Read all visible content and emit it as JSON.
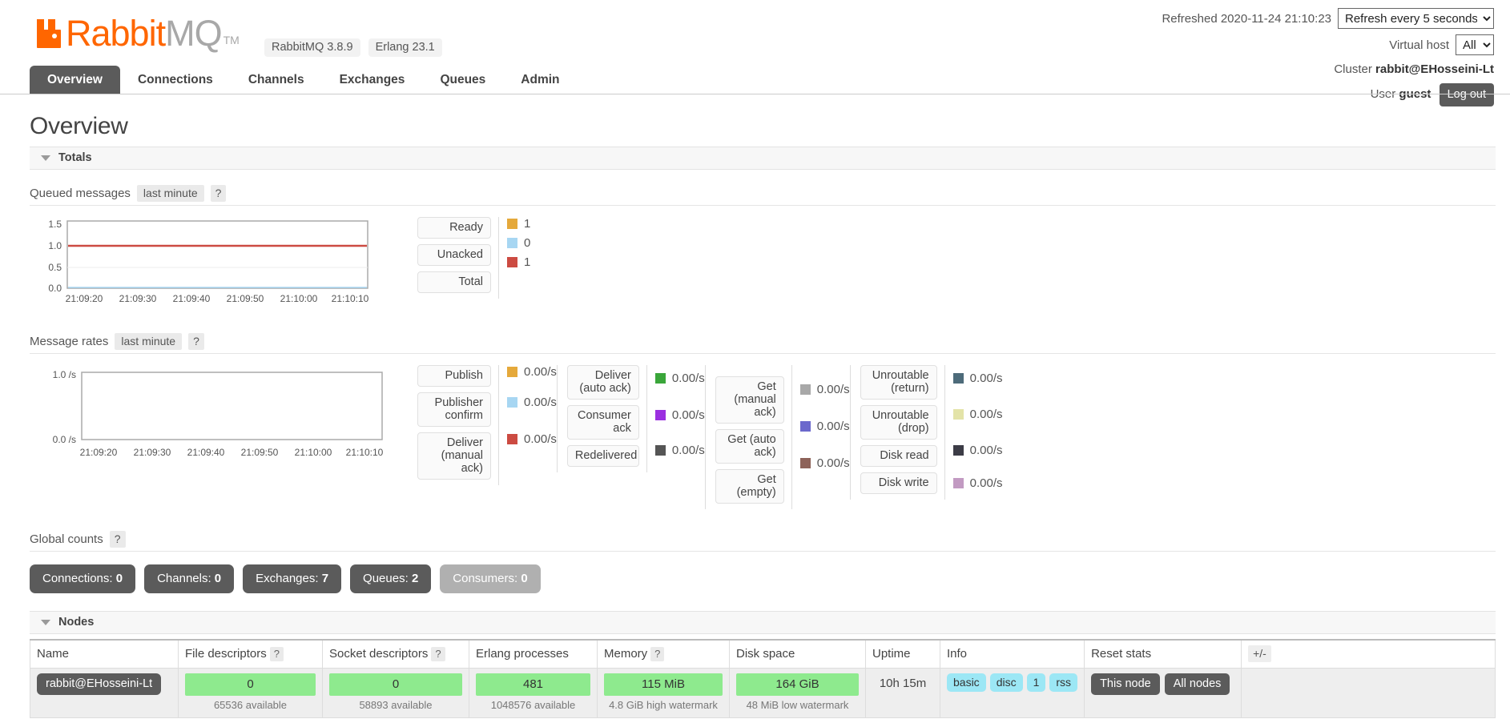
{
  "brand": {
    "name_part1": "Rabbit",
    "name_part2": "MQ",
    "tm": "TM",
    "logo_color": "#ff6600",
    "versions": [
      {
        "label": "RabbitMQ 3.8.9"
      },
      {
        "label": "Erlang 23.1"
      }
    ]
  },
  "topbar": {
    "refreshed_label": "Refreshed 2020-11-24 21:10:23",
    "refresh_select_value": "Refresh every 5 seconds",
    "refresh_options": [
      "Refresh every 5 seconds"
    ],
    "vhost_label": "Virtual host",
    "vhost_select_value": "All",
    "vhost_options": [
      "All"
    ],
    "cluster_label": "Cluster",
    "cluster_name": "rabbit@EHosseini-Lt",
    "user_label": "User",
    "user_name": "guest",
    "logout_label": "Log out"
  },
  "nav": {
    "tabs": [
      {
        "label": "Overview",
        "active": true
      },
      {
        "label": "Connections",
        "active": false
      },
      {
        "label": "Channels",
        "active": false
      },
      {
        "label": "Exchanges",
        "active": false
      },
      {
        "label": "Queues",
        "active": false
      },
      {
        "label": "Admin",
        "active": false
      }
    ]
  },
  "page": {
    "title": "Overview"
  },
  "totals": {
    "section_label": "Totals",
    "queued": {
      "title": "Queued messages",
      "period": "last minute",
      "help": "?"
    },
    "rates": {
      "title": "Message rates",
      "period": "last minute",
      "help": "?"
    }
  },
  "global_counts": {
    "title": "Global counts",
    "help": "?",
    "badges": [
      {
        "label": "Connections:",
        "value": "0",
        "muted": false
      },
      {
        "label": "Channels:",
        "value": "0",
        "muted": false
      },
      {
        "label": "Exchanges:",
        "value": "7",
        "muted": false
      },
      {
        "label": "Queues:",
        "value": "2",
        "muted": false
      },
      {
        "label": "Consumers:",
        "value": "0",
        "muted": true
      }
    ]
  },
  "nodes": {
    "section_label": "Nodes",
    "columns": [
      "Name",
      "File descriptors",
      "Socket descriptors",
      "Erlang processes",
      "Memory",
      "Disk space",
      "Uptime",
      "Info",
      "Reset stats"
    ],
    "col_help": {
      "file_descriptors": "?",
      "socket_descriptors": "?",
      "memory": "?"
    },
    "plusminus": "+/-",
    "row": {
      "name": "rabbit@EHosseini-Lt",
      "file_descriptors": "0",
      "file_descriptors_note": "65536 available",
      "socket_descriptors": "0",
      "socket_descriptors_note": "58893 available",
      "erlang_processes": "481",
      "erlang_processes_note": "1048576 available",
      "memory": "115 MiB",
      "memory_note": "4.8 GiB high watermark",
      "disk_space": "164 GiB",
      "disk_space_note": "48 MiB low watermark",
      "uptime": "10h 15m",
      "info_tags": [
        "basic",
        "disc",
        "1",
        "rss"
      ],
      "reset_buttons": [
        "This node",
        "All nodes"
      ]
    }
  },
  "chart_data": [
    {
      "id": "queued_messages",
      "type": "line",
      "title": "Queued messages",
      "subtitle": "last minute",
      "xlabel": "",
      "ylabel": "",
      "x": [
        "21:09:20",
        "21:09:30",
        "21:09:40",
        "21:09:50",
        "21:10:00",
        "21:10:10"
      ],
      "yticks": [
        0.0,
        0.5,
        1.0,
        1.5
      ],
      "ylim": [
        0.0,
        1.5
      ],
      "grid": true,
      "legend_position": "right",
      "series": [
        {
          "name": "Ready",
          "color": "#e5a93b",
          "value": "1",
          "values": [
            1,
            1,
            1,
            1,
            1,
            1
          ]
        },
        {
          "name": "Unacked",
          "color": "#a7d6f2",
          "value": "0",
          "values": [
            0,
            0,
            0,
            0,
            0,
            0
          ]
        },
        {
          "name": "Total",
          "color": "#cc4b42",
          "value": "1",
          "values": [
            1,
            1,
            1,
            1,
            1,
            1
          ]
        }
      ]
    },
    {
      "id": "message_rates",
      "type": "line",
      "title": "Message rates",
      "subtitle": "last minute",
      "xlabel": "",
      "ylabel": "",
      "x": [
        "21:09:20",
        "21:09:30",
        "21:09:40",
        "21:09:50",
        "21:10:00",
        "21:10:10"
      ],
      "yticks": [
        "0.0 /s",
        "1.0 /s"
      ],
      "ylim": [
        0.0,
        1.0
      ],
      "grid": false,
      "legend_position": "right",
      "groups": [
        {
          "names": [
            "Publish",
            "Publisher confirm",
            "Deliver (manual ack)"
          ],
          "values": [
            "0.00/s",
            "0.00/s",
            "0.00/s"
          ],
          "colors": [
            "#e5a93b",
            "#a7d6f2",
            "#cc4b42"
          ]
        },
        {
          "names": [
            "Deliver (auto ack)",
            "Consumer ack",
            "Redelivered"
          ],
          "values": [
            "0.00/s",
            "0.00/s",
            "0.00/s"
          ],
          "colors": [
            "#3aa63a",
            "#9b30e0",
            "#555555"
          ]
        },
        {
          "names": [
            "Get (manual ack)",
            "Get (auto ack)",
            "Get (empty)"
          ],
          "values": [
            "0.00/s",
            "0.00/s",
            "0.00/s"
          ],
          "colors": [
            "#a8a8a8",
            "#6b68cc",
            "#8d6259"
          ]
        },
        {
          "names": [
            "Unroutable (return)",
            "Unroutable (drop)",
            "Disk read",
            "Disk write"
          ],
          "values": [
            "0.00/s",
            "0.00/s",
            "0.00/s",
            "0.00/s"
          ],
          "colors": [
            "#4d6b7a",
            "#e3e3a8",
            "#3c3c46",
            "#c29ac2"
          ]
        }
      ]
    }
  ]
}
